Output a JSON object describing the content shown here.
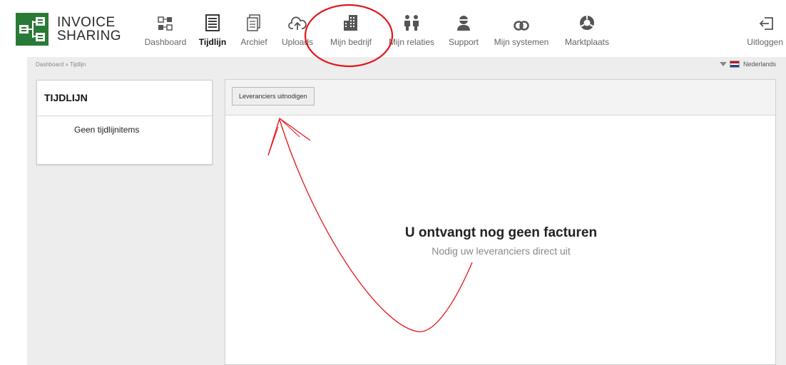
{
  "brand": {
    "line1": "INVOICE",
    "line2": "SHARING",
    "color": "#2a7a37"
  },
  "nav": [
    {
      "label": "Dashboard",
      "icon": "dashboard-icon"
    },
    {
      "label": "Tijdlijn",
      "icon": "timeline-icon",
      "active": true
    },
    {
      "label": "Archief",
      "icon": "archive-icon"
    },
    {
      "label": "Uploads",
      "icon": "cloud-upload-icon"
    },
    {
      "label": "Mijn bedrijf",
      "icon": "building-icon"
    },
    {
      "label": "Mijn relaties",
      "icon": "relations-icon"
    },
    {
      "label": "Support",
      "icon": "support-icon"
    },
    {
      "label": "Mijn systemen",
      "icon": "link-icon"
    },
    {
      "label": "Marktplaats",
      "icon": "marketplace-icon"
    }
  ],
  "logout": {
    "label": "Uitloggen",
    "icon": "logout-icon"
  },
  "breadcrumb": {
    "root": "Dashboard",
    "sep": "»",
    "current": "Tijdlijn"
  },
  "language": {
    "label": "Nederlands",
    "icon": "flag-nl-icon"
  },
  "timeline": {
    "title": "TIJDLIJN",
    "empty": "Geen tijdlijnitems"
  },
  "main": {
    "invite_button": "Leveranciers uitnodigen",
    "empty_title": "U ontvangt nog geen facturen",
    "empty_subtitle": "Nodig uw leveranciers direct uit"
  },
  "annotation_color": "#e3141b"
}
